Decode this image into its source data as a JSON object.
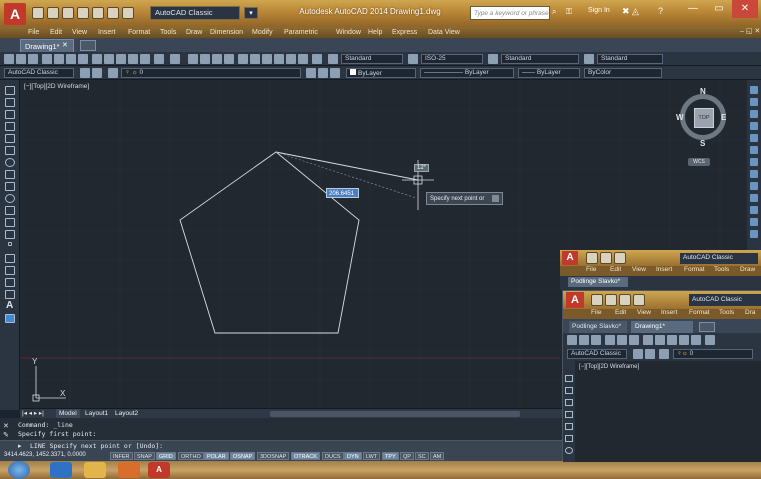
{
  "titlebar": {
    "workspace": "AutoCAD Classic",
    "title": "Autodesk AutoCAD 2014   Drawing1.dwg",
    "search_placeholder": "Type a keyword or phrase",
    "sign_in": "Sign In",
    "logo": "A"
  },
  "menubar": {
    "items": [
      "File",
      "Edit",
      "View",
      "Insert",
      "Format",
      "Tools",
      "Draw",
      "Dimension",
      "Modify",
      "Parametric",
      "Window",
      "Help",
      "Express",
      "Data View"
    ]
  },
  "doc_tab": "Drawing1*",
  "toolbar1": {
    "text_style": "Standard",
    "dim_style": "ISO-25",
    "table_style": "Standard",
    "multileader_style": "Standard"
  },
  "toolbar2": {
    "workspace": "AutoCAD Classic",
    "layer": "0",
    "color": "ByLayer",
    "linetype": "ByLayer",
    "lineweight": "ByLayer",
    "plotstyle": "ByColor"
  },
  "viewport_label": "[−][Top][2D Wireframe]",
  "viewcube": {
    "n": "N",
    "s": "S",
    "e": "E",
    "w": "W",
    "top": "TOP",
    "wcs": "WCS"
  },
  "tooltips": {
    "angle": "12°",
    "distance": "206.6451",
    "prompt": "Specify next point or"
  },
  "layout_tabs": [
    "Model",
    "Layout1",
    "Layout2"
  ],
  "command_history": [
    "Command: _line",
    "Specify first point:"
  ],
  "command_prompt": "LINE Specify next point or [Undo]:",
  "status": {
    "coords": "3414.4623, 1452.3371, 0.0000",
    "toggles": [
      {
        "label": "INFER",
        "on": false
      },
      {
        "label": "SNAP",
        "on": false
      },
      {
        "label": "GRID",
        "on": true
      },
      {
        "label": "ORTHO",
        "on": false
      },
      {
        "label": "POLAR",
        "on": true
      },
      {
        "label": "OSNAP",
        "on": true
      },
      {
        "label": "3DOSNAP",
        "on": false
      },
      {
        "label": "OTRACK",
        "on": true
      },
      {
        "label": "DUCS",
        "on": false
      },
      {
        "label": "DYN",
        "on": true
      },
      {
        "label": "LWT",
        "on": false
      },
      {
        "label": "TPY",
        "on": true
      },
      {
        "label": "QP",
        "on": false
      },
      {
        "label": "SC",
        "on": false
      },
      {
        "label": "AM",
        "on": false
      }
    ]
  },
  "overlay1": {
    "workspace": "AutoCAD Classic",
    "menu": [
      "File",
      "Edit",
      "View",
      "Insert",
      "Format",
      "Tools",
      "Draw"
    ],
    "tab": "Podlinge Slavko*"
  },
  "overlay2": {
    "workspace": "AutoCAD Classic",
    "menu": [
      "File",
      "Edit",
      "View",
      "Insert",
      "Format",
      "Tools",
      "Dra"
    ],
    "tabs": [
      "Podlinge Slavko*",
      "Drawing1*"
    ],
    "toolbar_workspace": "AutoCAD Classic",
    "viewport_label": "[−][Top][2D Wireframe]"
  }
}
